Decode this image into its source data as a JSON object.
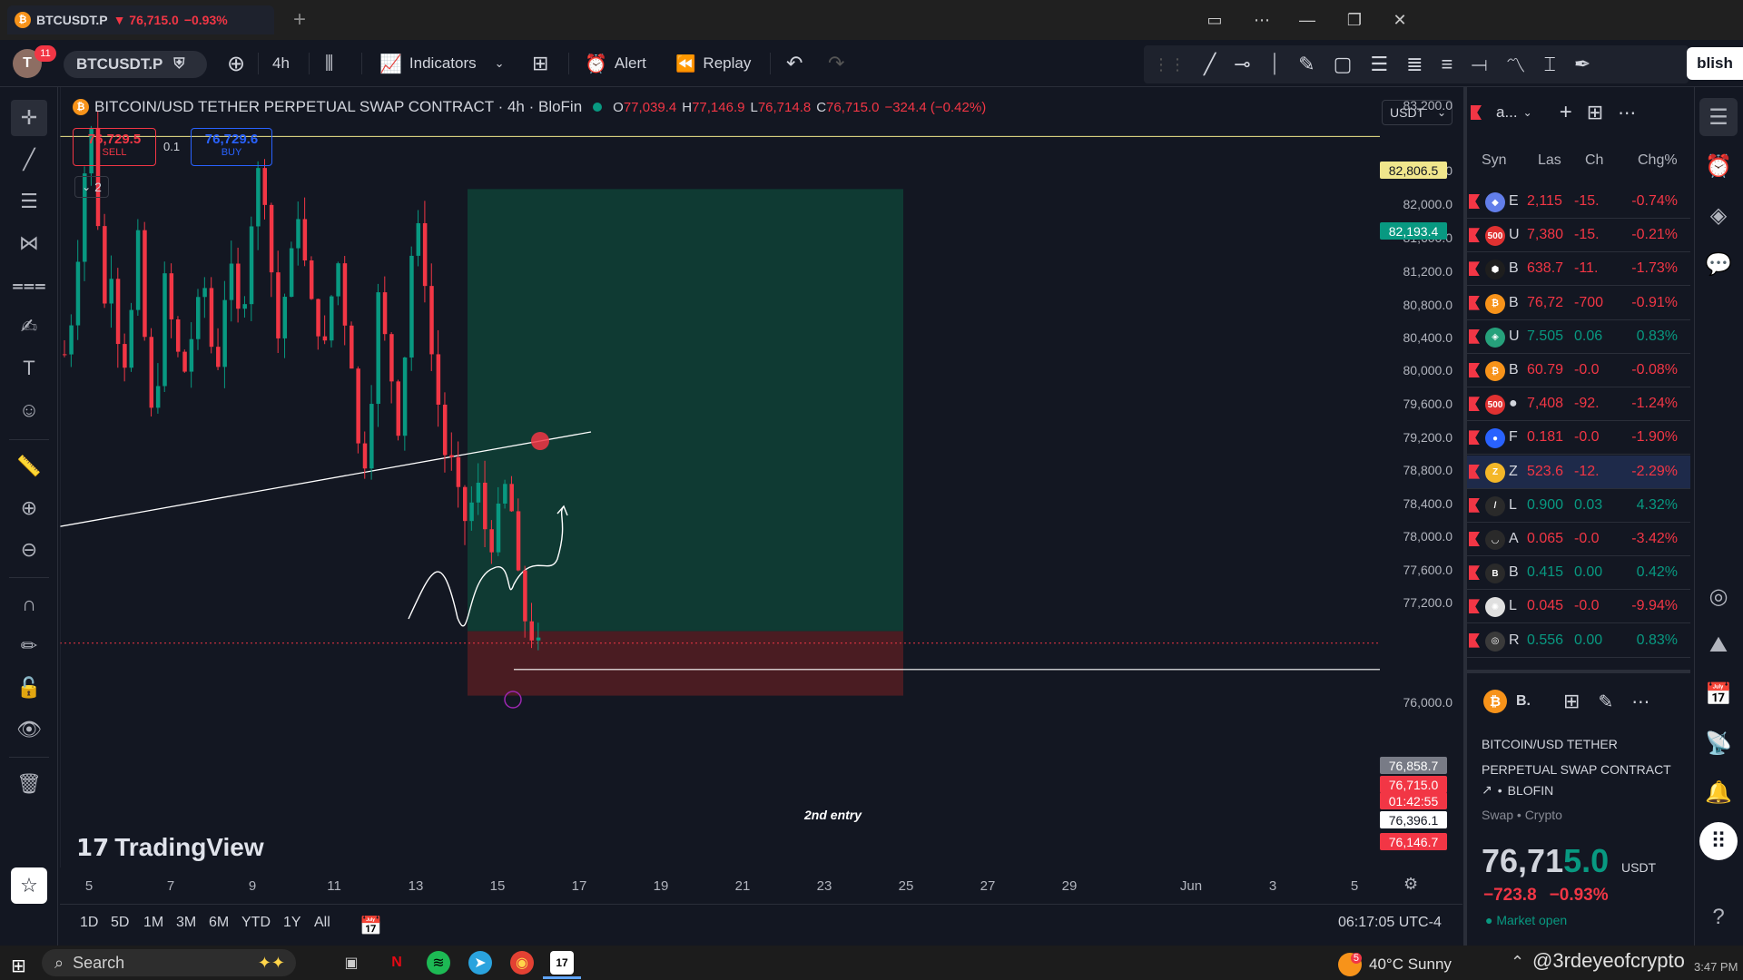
{
  "window": {
    "tab_title": "BTCUSDT.P",
    "tab_price": "▼ 76,715.0",
    "tab_change": "−0.93%",
    "new_tab": "+"
  },
  "toolbar": {
    "avatar_letter": "T",
    "notifications": "11",
    "symbol": "BTCUSDT.P",
    "interval": "4h",
    "indicators_label": "Indicators",
    "alert_label": "Alert",
    "replay_label": "Replay",
    "publish_label": "blish"
  },
  "chart": {
    "title": "BITCOIN/USD TETHER PERPETUAL SWAP CONTRACT · 4h · BloFin",
    "open_label": "O",
    "open": "77,039.4",
    "high_label": "H",
    "high": "77,146.9",
    "low_label": "L",
    "low": "76,714.8",
    "close_label": "C",
    "close": "76,715.0",
    "change": "−324.4 (−0.42%)",
    "sell_price": "76,729.5",
    "sell_label": "SELL",
    "spread": "0.1",
    "buy_price": "76,729.6",
    "buy_label": "BUY",
    "collapse_count": "2",
    "currency": "USDT",
    "annotation": "2nd entry",
    "logo_text": "TradingView",
    "price_axis": [
      "83,200.0",
      "82,400.0",
      "82,000.0",
      "81,600.0",
      "81,200.0",
      "80,800.0",
      "80,400.0",
      "80,000.0",
      "79,600.0",
      "79,200.0",
      "78,800.0",
      "78,400.0",
      "78,000.0",
      "77,600.0",
      "77,200.0",
      "76,000.0"
    ],
    "price_labels": {
      "top_line": "82,806.5",
      "target": "82,193.4",
      "entry": "76,858.7",
      "current": "76,715.0",
      "countdown": "01:42:55",
      "second_entry": "76,396.1",
      "stop": "76,146.7"
    },
    "time_axis": [
      "5",
      "7",
      "9",
      "11",
      "13",
      "15",
      "17",
      "19",
      "21",
      "23",
      "25",
      "27",
      "29",
      "Jun",
      "3",
      "5"
    ],
    "colors": {
      "up": "#089981",
      "down": "#f23645",
      "target_zone": "#0f3a33",
      "stop_zone": "#4a1c22"
    }
  },
  "bottom": {
    "timeframes": [
      "1D",
      "5D",
      "1M",
      "3M",
      "6M",
      "YTD",
      "1Y",
      "All"
    ],
    "clock": "06:17:05 UTC-4"
  },
  "watchlist": {
    "name": "a...",
    "columns": {
      "symbol": "Syn",
      "last": "Las",
      "chg": "Ch",
      "chgp": "Chg%"
    },
    "rows": [
      {
        "icon": "eth",
        "sym": "E",
        "last": "2,115",
        "chg": "-15.",
        "pct": "-0.74%",
        "dir": "down",
        "iconColor": "#627eea"
      },
      {
        "icon": "500",
        "sym": "U",
        "last": "7,380",
        "chg": "-15.",
        "pct": "-0.21%",
        "dir": "down",
        "iconColor": "#e03131"
      },
      {
        "icon": "bnb",
        "sym": "B",
        "last": "638.7",
        "chg": "-11.",
        "pct": "-1.73%",
        "dir": "down",
        "iconColor": "#1e1e1e"
      },
      {
        "icon": "btc",
        "sym": "B",
        "last": "76,72",
        "chg": "-700",
        "pct": "-0.91%",
        "dir": "down",
        "iconColor": "#f7931a"
      },
      {
        "icon": "usdt",
        "sym": "U",
        "last": "7.505",
        "chg": "0.06",
        "pct": "0.83%",
        "dir": "up",
        "iconColor": "#26a17b"
      },
      {
        "icon": "btc",
        "sym": "B",
        "last": "60.79",
        "chg": "-0.0",
        "pct": "-0.08%",
        "dir": "down",
        "iconColor": "#f7931a"
      },
      {
        "icon": "500",
        "sym": "●",
        "last": "7,408",
        "chg": "-92.",
        "pct": "-1.24%",
        "dir": "down",
        "iconColor": "#e03131"
      },
      {
        "icon": "fil",
        "sym": "F",
        "last": "0.181",
        "chg": "-0.0",
        "pct": "-1.90%",
        "dir": "down",
        "iconColor": "#2962ff"
      },
      {
        "icon": "zec",
        "sym": "Z",
        "last": "523.6",
        "chg": "-12.",
        "pct": "-2.29%",
        "dir": "down",
        "iconColor": "#f4b728",
        "selected": true
      },
      {
        "icon": "link",
        "sym": "L",
        "last": "0.900",
        "chg": "0.03",
        "pct": "4.32%",
        "dir": "up",
        "iconColor": "#2a2a2a"
      },
      {
        "icon": "arc",
        "sym": "A",
        "last": "0.065",
        "chg": "-0.0",
        "pct": "-3.42%",
        "dir": "down",
        "iconColor": "#2a2a2a"
      },
      {
        "icon": "bal",
        "sym": "B",
        "last": "0.415",
        "chg": "0.00",
        "pct": "0.42%",
        "dir": "up",
        "iconColor": "#2a2a2a"
      },
      {
        "icon": "lumen",
        "sym": "L",
        "last": "0.045",
        "chg": "-0.0",
        "pct": "-9.94%",
        "dir": "down",
        "iconColor": "#e0e0e0"
      },
      {
        "icon": "r",
        "sym": "R",
        "last": "0.556",
        "chg": "0.00",
        "pct": "0.83%",
        "dir": "up",
        "iconColor": "#3a3a3a"
      }
    ]
  },
  "details": {
    "short": "B.",
    "name": "BITCOIN/USD TETHER PERPETUAL SWAP CONTRACT",
    "exchange": "BLOFIN",
    "type": "Swap • Crypto",
    "price_main": "76,71",
    "price_tail": "5.0",
    "currency": "USDT",
    "change": "−723.8",
    "change_pct": "−0.93%",
    "status": "● Market open"
  },
  "taskbar": {
    "search": "Search",
    "weather": "40°C  Sunny",
    "weather_badge": "5",
    "watermark": "@3rdeyeofcrypto",
    "time": "3:47 PM"
  }
}
